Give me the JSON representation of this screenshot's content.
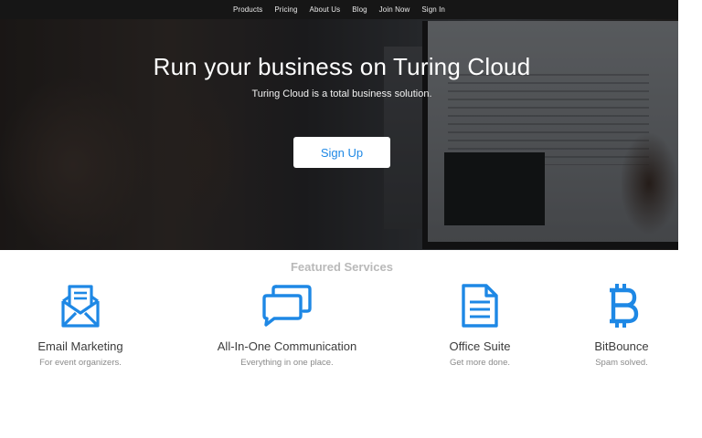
{
  "nav": {
    "items": [
      {
        "label": "Products"
      },
      {
        "label": "Pricing"
      },
      {
        "label": "About Us"
      },
      {
        "label": "Blog"
      },
      {
        "label": "Join Now"
      },
      {
        "label": "Sign In"
      }
    ]
  },
  "hero": {
    "title": "Run your business on Turing Cloud",
    "subtitle": "Turing Cloud is a total business solution.",
    "signup_label": "Sign Up"
  },
  "featured": {
    "heading": "Featured Services",
    "services": [
      {
        "name": "Email Marketing",
        "description": "For event organizers.",
        "icon": "envelope-icon"
      },
      {
        "name": "All-In-One Communication",
        "description": "Everything in one place.",
        "icon": "chat-bubbles-icon"
      },
      {
        "name": "Office Suite",
        "description": "Get more done.",
        "icon": "document-icon"
      },
      {
        "name": "BitBounce",
        "description": "Spam solved.",
        "icon": "bitcoin-icon"
      }
    ]
  },
  "colors": {
    "accent": "#1e88e5",
    "navbar": "#161616",
    "heading_gray": "#b9b9b9"
  }
}
